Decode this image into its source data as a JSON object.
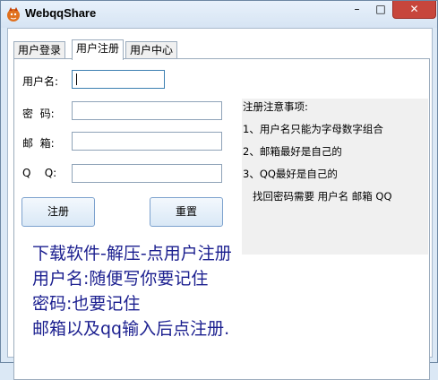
{
  "window": {
    "title": "WebqqShare",
    "controls": {
      "minimize": "–",
      "maximize": "□",
      "close": "✕"
    }
  },
  "tabs": [
    {
      "label": "用户登录",
      "active": false
    },
    {
      "label": "用户注册",
      "active": true
    },
    {
      "label": "用户中心",
      "active": false
    }
  ],
  "form": {
    "username_label": "用户名:",
    "password_label": "密  码:",
    "email_label": "邮  箱:",
    "qq_label": "Q    Q:",
    "username_value": "",
    "password_value": "",
    "email_value": "",
    "qq_value": "",
    "register_button": "注册",
    "reset_button": "重置"
  },
  "notes": {
    "title": "注册注意事项:",
    "items": [
      "1、用户名只能为字母数字组合",
      "2、邮箱最好是自己的",
      "3、QQ最好是自己的",
      "   找回密码需要 用户名 邮箱 QQ"
    ]
  },
  "instructions": [
    "下载软件-解压-点用户注册",
    "用户名:随便写你要记住",
    "密码:也要记住",
    "邮箱以及qq输入后点注册."
  ],
  "watermark": {
    "icon": "download-site-logo-icon"
  },
  "colors": {
    "instruction_text": "#1b1f8f",
    "close_button": "#c7463c",
    "window_bg": "#dbe8f5"
  }
}
